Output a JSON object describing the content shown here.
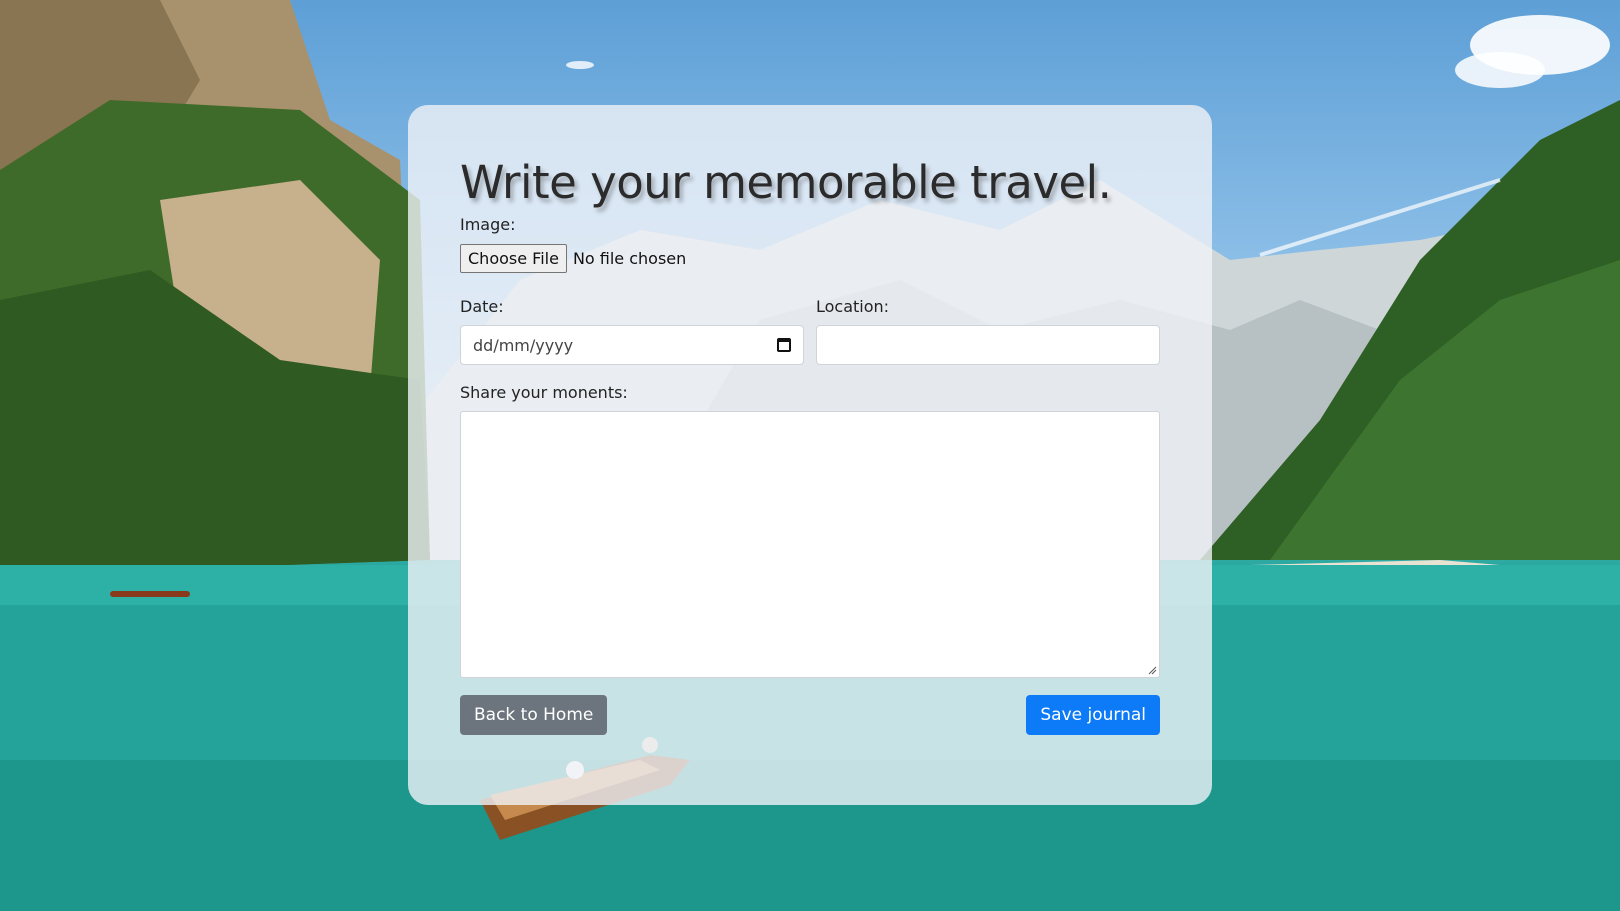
{
  "page": {
    "title": "Write your memorable travel."
  },
  "form": {
    "image_label": "Image:",
    "file_button_label": "Choose File",
    "file_status": "No file chosen",
    "date_label": "Date:",
    "date_placeholder": "dd/mm/yyyy",
    "location_label": "Location:",
    "location_value": "",
    "moments_label": "Share your monents:",
    "moments_value": ""
  },
  "actions": {
    "back_label": "Back to Home",
    "save_label": "Save journal"
  },
  "colors": {
    "save_button": "#0d7bf7",
    "back_button": "#6c757d"
  },
  "icons": {
    "date_picker": "calendar-icon"
  }
}
